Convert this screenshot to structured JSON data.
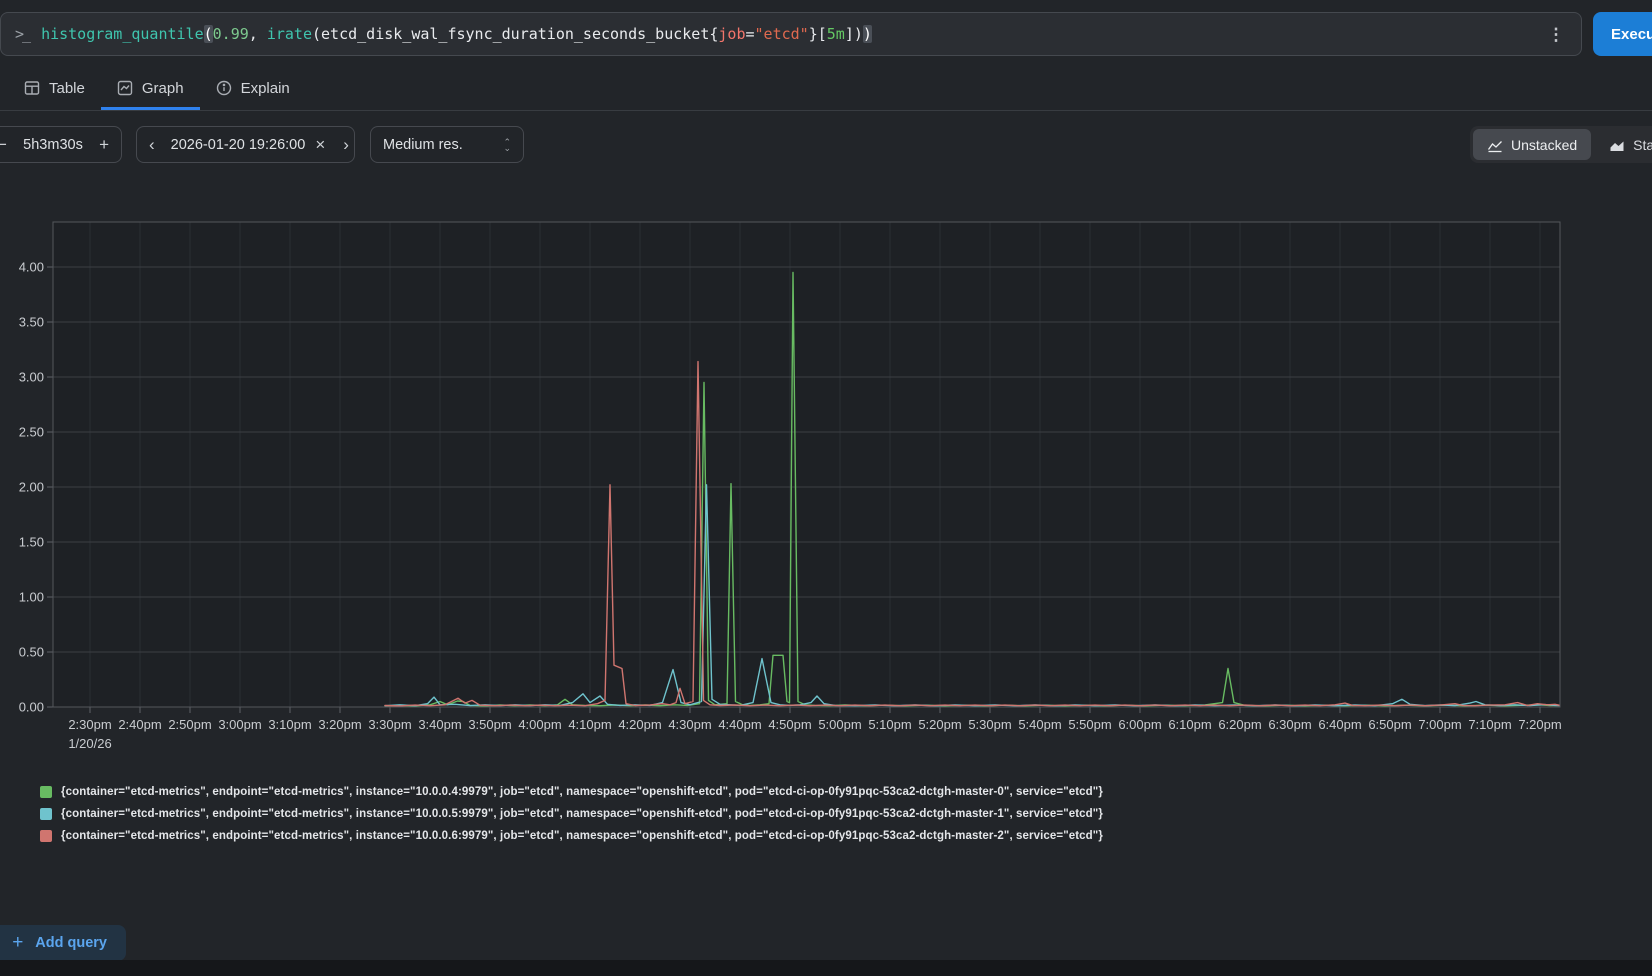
{
  "query_bar": {
    "prompt": ">_",
    "query_full": "histogram_quantile(0.99, irate(etcd_disk_wal_fsync_duration_seconds_bucket{job=\"etcd\"}[5m]))",
    "segments": [
      {
        "t": "histogram_quantile",
        "c": "func"
      },
      {
        "t": "(",
        "c": "match"
      },
      {
        "t": "0.99",
        "c": "num"
      },
      {
        "t": ", ",
        "c": "plain"
      },
      {
        "t": "irate",
        "c": "func"
      },
      {
        "t": "(",
        "c": "plain"
      },
      {
        "t": "etcd_disk_wal_fsync_duration_seconds_bucket",
        "c": "metric"
      },
      {
        "t": "{",
        "c": "plain"
      },
      {
        "t": "job",
        "c": "label"
      },
      {
        "t": "=",
        "c": "plain"
      },
      {
        "t": "\"etcd\"",
        "c": "str"
      },
      {
        "t": "}",
        "c": "plain"
      },
      {
        "t": "[",
        "c": "plain"
      },
      {
        "t": "5m",
        "c": "dur"
      },
      {
        "t": "]",
        "c": "plain"
      },
      {
        "t": ")",
        "c": "plain"
      },
      {
        "t": ")",
        "c": "match"
      }
    ],
    "kebab": "⋮",
    "execute_label": "Execute"
  },
  "tabs": [
    {
      "label": "Table",
      "active": false
    },
    {
      "label": "Graph",
      "active": true
    },
    {
      "label": "Explain",
      "active": false
    }
  ],
  "toolbar": {
    "duration": {
      "decrease": "−",
      "value": "5h3m30s",
      "increase": "+"
    },
    "datetime": {
      "prev": "‹",
      "value": "2026-01-20 19:26:00",
      "clear": "×",
      "next": "›"
    },
    "resolution": {
      "value": "Medium res."
    },
    "stacking": {
      "unstacked_label": "Unstacked",
      "stacked_label": "Stacked",
      "active": "unstacked"
    }
  },
  "chart_data": {
    "type": "line",
    "title": "",
    "xlabel": "",
    "ylabel": "",
    "grid": true,
    "legend_position": "bottom",
    "x_unit": "minutes after 2:30pm on 1/20/26",
    "date_label": "1/20/26",
    "x_ticks": [
      "2:30pm",
      "2:40pm",
      "2:50pm",
      "3:00pm",
      "3:10pm",
      "3:20pm",
      "3:30pm",
      "3:40pm",
      "3:50pm",
      "4:00pm",
      "4:10pm",
      "4:20pm",
      "4:30pm",
      "4:40pm",
      "4:50pm",
      "5:00pm",
      "5:10pm",
      "5:20pm",
      "5:30pm",
      "5:40pm",
      "5:50pm",
      "6:00pm",
      "6:10pm",
      "6:20pm",
      "6:30pm",
      "6:40pm",
      "6:50pm",
      "7:00pm",
      "7:10pm",
      "7:20pm"
    ],
    "y_ticks": [
      "0.00",
      "0.50",
      "1.00",
      "1.50",
      "2.00",
      "2.50",
      "3.00",
      "3.50",
      "4.00"
    ],
    "ylim": [
      0,
      4.41
    ],
    "series": [
      {
        "name": "instance 10.0.0.4:9979 (master-0)",
        "color": "#68bb62",
        "points": [
          [
            59,
            0.01
          ],
          [
            62,
            0.015
          ],
          [
            65,
            0.01
          ],
          [
            68,
            0.02
          ],
          [
            70,
            0.05
          ],
          [
            71.5,
            0.02
          ],
          [
            73.5,
            0.055
          ],
          [
            74.6,
            0.05
          ],
          [
            76,
            0.015
          ],
          [
            79,
            0.01
          ],
          [
            82,
            0.018
          ],
          [
            85,
            0.012
          ],
          [
            88,
            0.018
          ],
          [
            91,
            0.012
          ],
          [
            93.5,
            0.02
          ],
          [
            95,
            0.07
          ],
          [
            96.5,
            0.02
          ],
          [
            99,
            0.015
          ],
          [
            102,
            0.012
          ],
          [
            105,
            0.018
          ],
          [
            108,
            0.012
          ],
          [
            111,
            0.018
          ],
          [
            114,
            0.012
          ],
          [
            117,
            0.02
          ],
          [
            119.5,
            0.015
          ],
          [
            121.9,
            0.03
          ],
          [
            122.8,
            2.95
          ],
          [
            123.7,
            0.06
          ],
          [
            125,
            0.02
          ],
          [
            127.4,
            0.03
          ],
          [
            128.2,
            2.03
          ],
          [
            129.1,
            0.05
          ],
          [
            130.5,
            0.02
          ],
          [
            132,
            0.015
          ],
          [
            134,
            0.02
          ],
          [
            135.8,
            0.03
          ],
          [
            136.6,
            0.47
          ],
          [
            138.6,
            0.47
          ],
          [
            139.4,
            0.05
          ],
          [
            139.9,
            0.04
          ],
          [
            140.6,
            3.95
          ],
          [
            141.6,
            0.05
          ],
          [
            143,
            0.02
          ],
          [
            145,
            0.015
          ],
          [
            148,
            0.012
          ],
          [
            151,
            0.018
          ],
          [
            155,
            0.012
          ],
          [
            159,
            0.016
          ],
          [
            163,
            0.011
          ],
          [
            167,
            0.016
          ],
          [
            171,
            0.011
          ],
          [
            175,
            0.016
          ],
          [
            179,
            0.011
          ],
          [
            183,
            0.016
          ],
          [
            187,
            0.011
          ],
          [
            191,
            0.016
          ],
          [
            195,
            0.011
          ],
          [
            199,
            0.016
          ],
          [
            203,
            0.011
          ],
          [
            207,
            0.016
          ],
          [
            211,
            0.011
          ],
          [
            215,
            0.016
          ],
          [
            219,
            0.012
          ],
          [
            223,
            0.018
          ],
          [
            226.5,
            0.04
          ],
          [
            227.6,
            0.35
          ],
          [
            228.8,
            0.04
          ],
          [
            231,
            0.015
          ],
          [
            235,
            0.011
          ],
          [
            239,
            0.016
          ],
          [
            243,
            0.011
          ],
          [
            247,
            0.016
          ],
          [
            251,
            0.011
          ],
          [
            255,
            0.016
          ],
          [
            259,
            0.011
          ],
          [
            263,
            0.016
          ],
          [
            267,
            0.011
          ],
          [
            271,
            0.016
          ],
          [
            275,
            0.011
          ],
          [
            279,
            0.016
          ],
          [
            283,
            0.011
          ],
          [
            287,
            0.016
          ],
          [
            290,
            0.02
          ],
          [
            292,
            0.013
          ],
          [
            294,
            0.015
          ]
        ]
      },
      {
        "name": "instance 10.0.0.5:9979 (master-1)",
        "color": "#6fc3cd",
        "points": [
          [
            59,
            0.012
          ],
          [
            62,
            0.02
          ],
          [
            65,
            0.012
          ],
          [
            67.5,
            0.03
          ],
          [
            68.8,
            0.09
          ],
          [
            70,
            0.02
          ],
          [
            73,
            0.025
          ],
          [
            76,
            0.013
          ],
          [
            79,
            0.02
          ],
          [
            82,
            0.013
          ],
          [
            85,
            0.02
          ],
          [
            88,
            0.013
          ],
          [
            91,
            0.02
          ],
          [
            94,
            0.015
          ],
          [
            96.5,
            0.04
          ],
          [
            98.6,
            0.12
          ],
          [
            100,
            0.04
          ],
          [
            102,
            0.1
          ],
          [
            103.5,
            0.025
          ],
          [
            106,
            0.015
          ],
          [
            109,
            0.02
          ],
          [
            112,
            0.015
          ],
          [
            114.5,
            0.04
          ],
          [
            116.6,
            0.34
          ],
          [
            118.2,
            0.04
          ],
          [
            120,
            0.02
          ],
          [
            122.3,
            0.05
          ],
          [
            123.3,
            2.02
          ],
          [
            124.4,
            0.07
          ],
          [
            126,
            0.025
          ],
          [
            128,
            0.02
          ],
          [
            130,
            0.015
          ],
          [
            132.6,
            0.04
          ],
          [
            134.4,
            0.44
          ],
          [
            136.2,
            0.04
          ],
          [
            138,
            0.02
          ],
          [
            140,
            0.015
          ],
          [
            142,
            0.02
          ],
          [
            144.2,
            0.04
          ],
          [
            145.4,
            0.1
          ],
          [
            146.8,
            0.03
          ],
          [
            149,
            0.015
          ],
          [
            153,
            0.012
          ],
          [
            157,
            0.018
          ],
          [
            161,
            0.012
          ],
          [
            165,
            0.018
          ],
          [
            169,
            0.012
          ],
          [
            173,
            0.018
          ],
          [
            177,
            0.012
          ],
          [
            181,
            0.018
          ],
          [
            185,
            0.012
          ],
          [
            189,
            0.018
          ],
          [
            193,
            0.012
          ],
          [
            197,
            0.018
          ],
          [
            201,
            0.012
          ],
          [
            205,
            0.018
          ],
          [
            209,
            0.012
          ],
          [
            213,
            0.018
          ],
          [
            217,
            0.012
          ],
          [
            221,
            0.018
          ],
          [
            225,
            0.012
          ],
          [
            229,
            0.018
          ],
          [
            233,
            0.012
          ],
          [
            237,
            0.018
          ],
          [
            241,
            0.012
          ],
          [
            245,
            0.018
          ],
          [
            249,
            0.012
          ],
          [
            253,
            0.018
          ],
          [
            257,
            0.012
          ],
          [
            260.5,
            0.03
          ],
          [
            262.4,
            0.07
          ],
          [
            264,
            0.025
          ],
          [
            267,
            0.013
          ],
          [
            270,
            0.018
          ],
          [
            273,
            0.013
          ],
          [
            276,
            0.035
          ],
          [
            277.2,
            0.05
          ],
          [
            279,
            0.02
          ],
          [
            282,
            0.014
          ],
          [
            285,
            0.02
          ],
          [
            288,
            0.013
          ],
          [
            291,
            0.022
          ],
          [
            293,
            0.015
          ],
          [
            294,
            0.013
          ]
        ]
      },
      {
        "name": "instance 10.0.0.6:9979 (master-2)",
        "color": "#d0756f",
        "points": [
          [
            59,
            0.014
          ],
          [
            62,
            0.01
          ],
          [
            65,
            0.017
          ],
          [
            68,
            0.012
          ],
          [
            71,
            0.02
          ],
          [
            73.6,
            0.08
          ],
          [
            75,
            0.035
          ],
          [
            76.4,
            0.06
          ],
          [
            78,
            0.016
          ],
          [
            81,
            0.012
          ],
          [
            84,
            0.017
          ],
          [
            87,
            0.012
          ],
          [
            90,
            0.016
          ],
          [
            93,
            0.012
          ],
          [
            96,
            0.016
          ],
          [
            99,
            0.012
          ],
          [
            101.5,
            0.03
          ],
          [
            103,
            0.06
          ],
          [
            104,
            2.02
          ],
          [
            104.8,
            0.38
          ],
          [
            106.4,
            0.35
          ],
          [
            107.2,
            0.03
          ],
          [
            109,
            0.014
          ],
          [
            112,
            0.018
          ],
          [
            114.5,
            0.03
          ],
          [
            116,
            0.02
          ],
          [
            117.2,
            0.04
          ],
          [
            118,
            0.17
          ],
          [
            119,
            0.03
          ],
          [
            120.6,
            0.05
          ],
          [
            121.6,
            3.14
          ],
          [
            122.7,
            0.06
          ],
          [
            124,
            0.02
          ],
          [
            126,
            0.014
          ],
          [
            129,
            0.018
          ],
          [
            132,
            0.012
          ],
          [
            135,
            0.017
          ],
          [
            138,
            0.012
          ],
          [
            141,
            0.017
          ],
          [
            144,
            0.012
          ],
          [
            147,
            0.017
          ],
          [
            150,
            0.012
          ],
          [
            153,
            0.017
          ],
          [
            156,
            0.012
          ],
          [
            159,
            0.017
          ],
          [
            162,
            0.012
          ],
          [
            165,
            0.017
          ],
          [
            168,
            0.012
          ],
          [
            171,
            0.017
          ],
          [
            174,
            0.012
          ],
          [
            177,
            0.017
          ],
          [
            180,
            0.012
          ],
          [
            183,
            0.017
          ],
          [
            186,
            0.012
          ],
          [
            189,
            0.017
          ],
          [
            192,
            0.012
          ],
          [
            195,
            0.017
          ],
          [
            198,
            0.012
          ],
          [
            201,
            0.017
          ],
          [
            204,
            0.012
          ],
          [
            207,
            0.017
          ],
          [
            210,
            0.012
          ],
          [
            213,
            0.017
          ],
          [
            216,
            0.012
          ],
          [
            219,
            0.017
          ],
          [
            222,
            0.012
          ],
          [
            225,
            0.017
          ],
          [
            228,
            0.012
          ],
          [
            231,
            0.017
          ],
          [
            234,
            0.012
          ],
          [
            237,
            0.017
          ],
          [
            240,
            0.012
          ],
          [
            243,
            0.017
          ],
          [
            246,
            0.012
          ],
          [
            249,
            0.02
          ],
          [
            251,
            0.035
          ],
          [
            252.5,
            0.015
          ],
          [
            255,
            0.012
          ],
          [
            258,
            0.017
          ],
          [
            261,
            0.012
          ],
          [
            264,
            0.017
          ],
          [
            267,
            0.012
          ],
          [
            270,
            0.017
          ],
          [
            273,
            0.03
          ],
          [
            274.5,
            0.015
          ],
          [
            277,
            0.012
          ],
          [
            280,
            0.017
          ],
          [
            283,
            0.02
          ],
          [
            285.5,
            0.04
          ],
          [
            287.5,
            0.015
          ],
          [
            289.5,
            0.03
          ],
          [
            291.5,
            0.02
          ],
          [
            293,
            0.025
          ],
          [
            294,
            0.015
          ]
        ]
      }
    ]
  },
  "legend": [
    {
      "color": "#68bb62",
      "label": "{container=\"etcd-metrics\", endpoint=\"etcd-metrics\", instance=\"10.0.0.4:9979\", job=\"etcd\", namespace=\"openshift-etcd\", pod=\"etcd-ci-op-0fy91pqc-53ca2-dctgh-master-0\", service=\"etcd\"}"
    },
    {
      "color": "#6fc3cd",
      "label": "{container=\"etcd-metrics\", endpoint=\"etcd-metrics\", instance=\"10.0.0.5:9979\", job=\"etcd\", namespace=\"openshift-etcd\", pod=\"etcd-ci-op-0fy91pqc-53ca2-dctgh-master-1\", service=\"etcd\"}"
    },
    {
      "color": "#d0756f",
      "label": "{container=\"etcd-metrics\", endpoint=\"etcd-metrics\", instance=\"10.0.0.6:9979\", job=\"etcd\", namespace=\"openshift-etcd\", pod=\"etcd-ci-op-0fy91pqc-53ca2-dctgh-master-2\", service=\"etcd\"}"
    }
  ],
  "add_query": {
    "label": "Add query",
    "icon": "+"
  }
}
